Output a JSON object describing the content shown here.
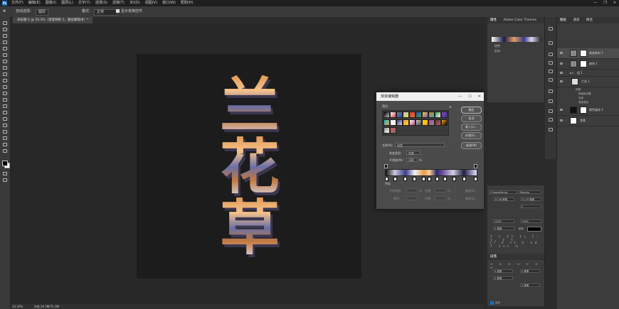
{
  "app": {
    "logo": "Ps",
    "menu": [
      "文件(F)",
      "编辑(E)",
      "图像(I)",
      "图层(L)",
      "文字(Y)",
      "选择(S)",
      "滤镜(T)",
      "3D(D)",
      "视图(V)",
      "窗口(W)",
      "帮助(H)"
    ],
    "window_controls": [
      "—",
      "❐",
      "✕"
    ]
  },
  "options_bar": {
    "source_label": "自动选择：",
    "source_value": "图层",
    "mode_label": "模式：",
    "mode_value": "正常",
    "extra_label": "显示变换控件"
  },
  "document": {
    "tab_title": "未标题-1 @ 33.3%（渐变映射 1，图层蒙版/8）*"
  },
  "canvas_text": [
    "兰",
    "花",
    "草"
  ],
  "status_bar": {
    "zoom": "33.33%",
    "doc_info": "文档:10.3M/71.3M"
  },
  "gradient_editor": {
    "title": "渐变编辑器",
    "window_controls": [
      "—",
      "☐",
      "✕"
    ],
    "presets_label": "预设",
    "buttons": {
      "ok": "确定",
      "cancel": "取消",
      "load": "载入(L)...",
      "save": "存储(S)...",
      "new": "新建(W)"
    },
    "name_label": "名称(N):",
    "name_value": "自定",
    "type_label": "渐变类型:",
    "type_value": "实底",
    "smooth_label": "平滑度(M):",
    "smooth_value": "100",
    "smooth_unit": "%",
    "stops_label": "色标",
    "opacity_label": "不透明度:",
    "location_label": "位置:",
    "delete_label": "删除(D)",
    "color_label": "颜色:",
    "percent": "%",
    "preset_colors": [
      "#000000",
      "#ffffff",
      "#777777",
      "#c0c0c0",
      "#d04040",
      "#2050c0",
      "#e0e040",
      "#e07020",
      "#40a040",
      "#9040c0",
      "#20c0c0",
      "#f0f0f0",
      "#3a3a90",
      "#e0a060",
      "#ffffff",
      "#d0d0d0",
      "#ffd700",
      "#c04080",
      "#404040",
      "#f5a623",
      "#8e8e8e",
      "#e65050"
    ]
  },
  "properties_panel": {
    "tabs": [
      "属性",
      "Adobe Color Themes"
    ],
    "row1": "仿色",
    "row2": "反向"
  },
  "character_panel": {
    "font": "Chaoweifengs",
    "style": "Regular",
    "size": "33.48 像素",
    "leading": "31.29 像素",
    "tracking": "0",
    "scale_v": "100%",
    "scale_h": "100%",
    "baseline": "0 像素",
    "color_label": "颜色",
    "paragraph_tab": "段落",
    "indent_left": "0 像素",
    "indent_right": "0 像素",
    "space_before": "0 像素",
    "space_after": "0 像素",
    "hyphenate": "连字"
  },
  "layers_panel": {
    "tabs": [
      "图层",
      "通道",
      "路径"
    ],
    "layers": [
      {
        "name": "渐变映射 1",
        "selected": true
      },
      {
        "name": "曲线 1",
        "selected": false
      },
      {
        "name": "组 1",
        "selected": false
      },
      {
        "name": "兰花 1",
        "selected": false
      },
      {
        "name": "效果",
        "selected": false
      },
      {
        "name": "斜面和浮雕",
        "selected": false
      },
      {
        "name": "光泽",
        "selected": false
      },
      {
        "name": "渐变叠加",
        "selected": false
      },
      {
        "name": "颜色填充 1",
        "selected": false
      },
      {
        "name": "背景",
        "selected": false
      }
    ]
  },
  "colors": {
    "accent": "#1b6fb8",
    "panel": "#3c3c3c",
    "canvas": "#1c1c1c"
  }
}
